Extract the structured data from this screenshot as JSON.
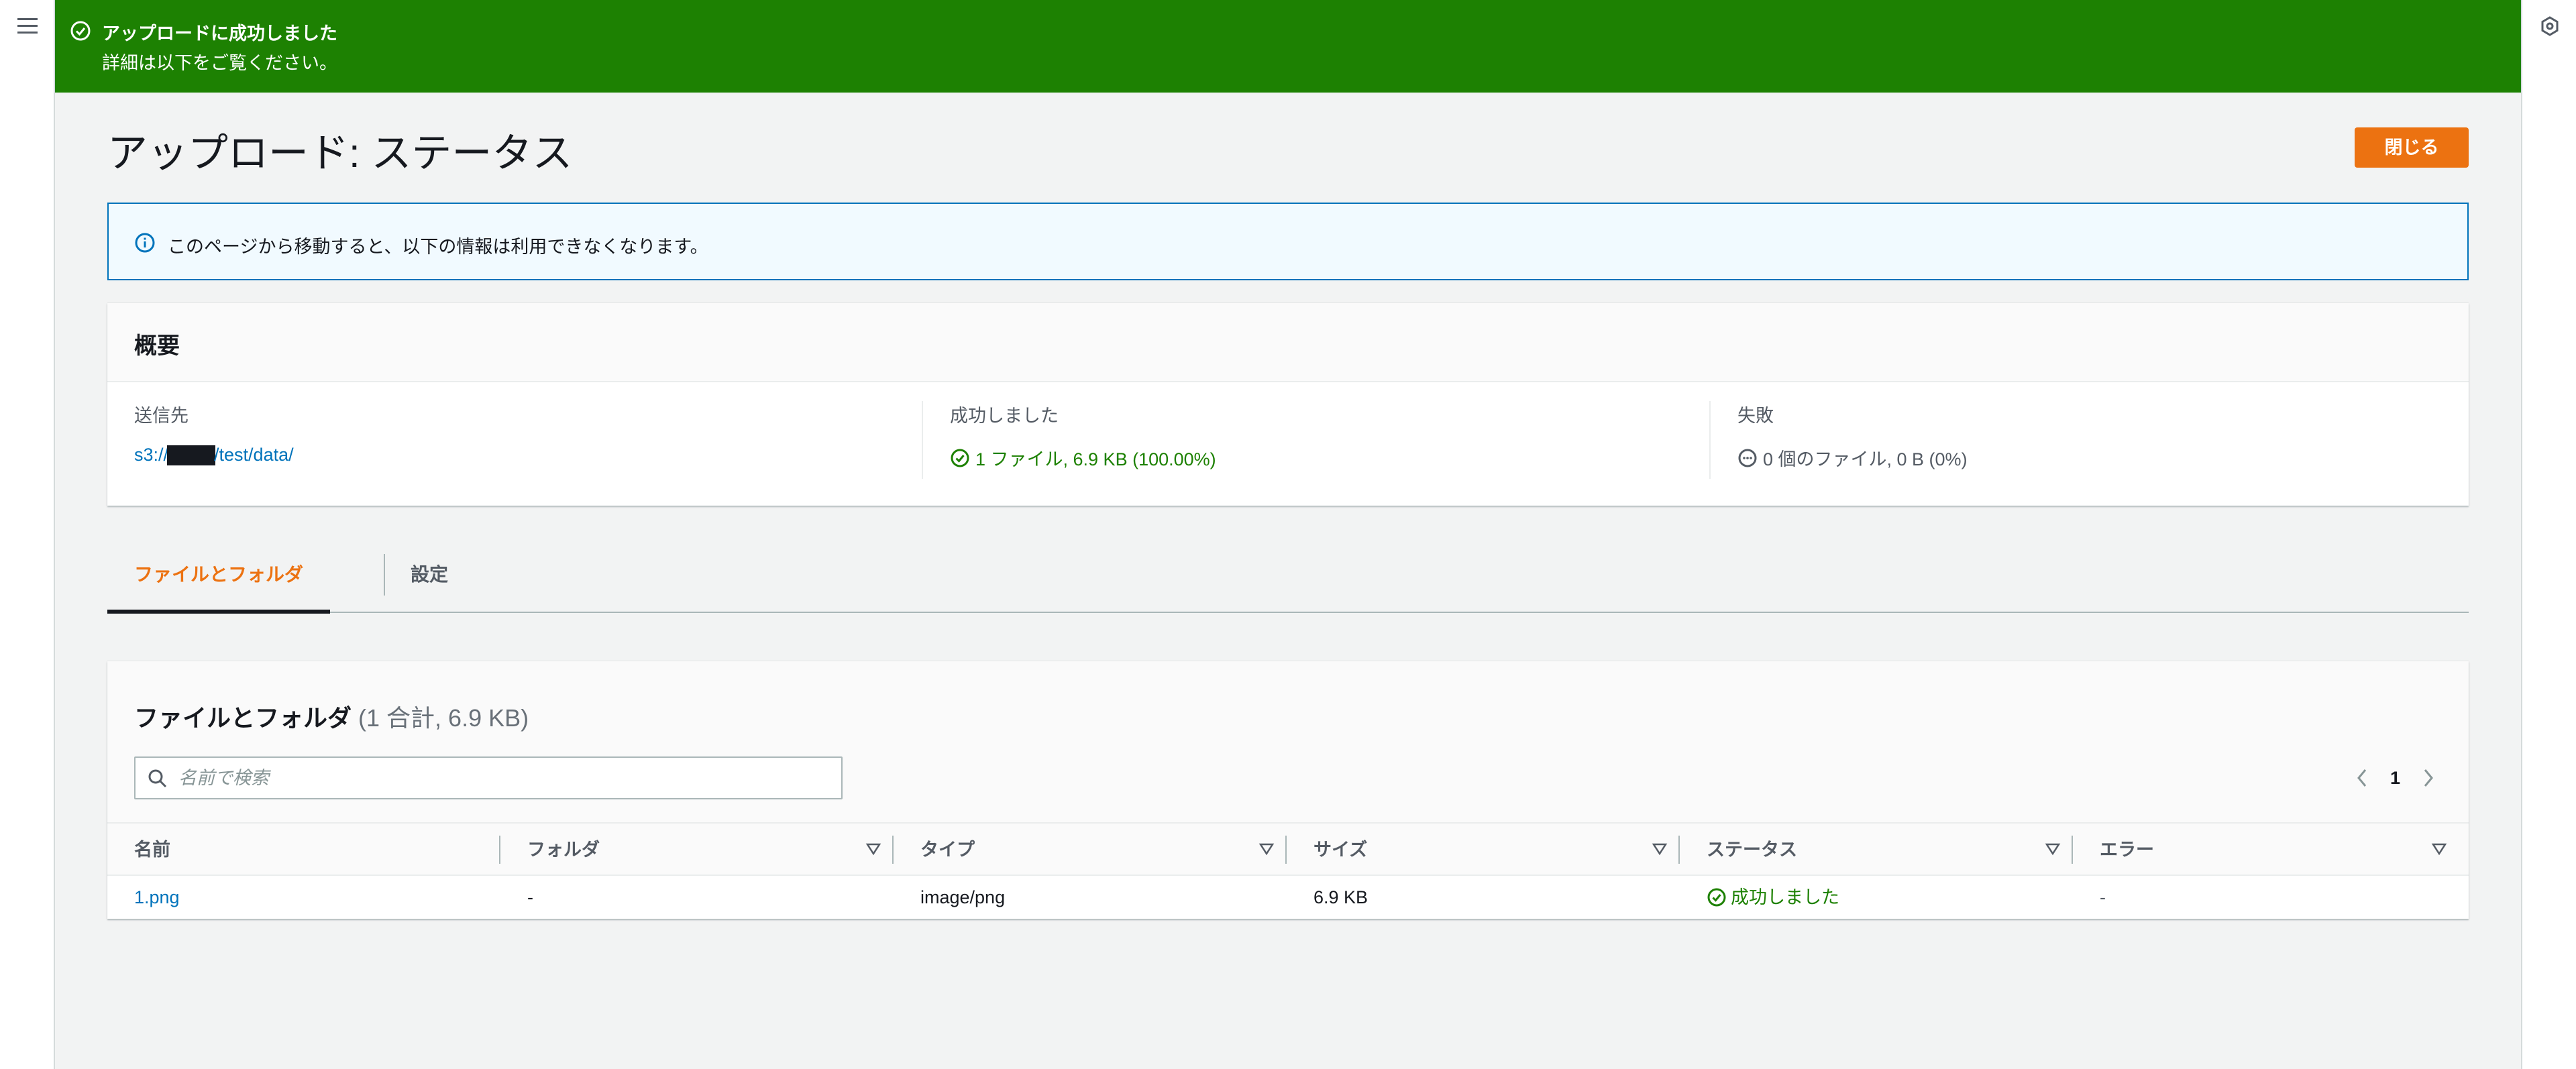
{
  "flash": {
    "title": "アップロードに成功しました",
    "message": "詳細は以下をご覧ください。",
    "color": "#1d8102"
  },
  "page": {
    "title": "アップロード: ステータス",
    "close_label": "閉じる"
  },
  "info": {
    "text": "このページから移動すると、以下の情報は利用できなくなります。"
  },
  "summary": {
    "heading": "概要",
    "destination_label": "送信先",
    "destination_prefix": "s3://",
    "destination_suffix": "/test/data/",
    "succeeded_label": "成功しました",
    "succeeded_value": "1 ファイル, 6.9 KB (100.00%)",
    "failed_label": "失敗",
    "failed_value": "0 個のファイル, 0 B (0%)"
  },
  "tabs": [
    {
      "label": "ファイルとフォルダ",
      "active": true
    },
    {
      "label": "設定",
      "active": false
    }
  ],
  "files": {
    "heading": "ファイルとフォルダ",
    "count": "(1 合計, 6.9 KB)",
    "search_placeholder": "名前で検索",
    "current_page": "1",
    "columns": [
      "名前",
      "フォルダ",
      "タイプ",
      "サイズ",
      "ステータス",
      "エラー"
    ],
    "rows": [
      {
        "name": "1.png",
        "folder": "-",
        "type": "image/png",
        "size": "6.9 KB",
        "status": "成功しました",
        "error": "-"
      }
    ]
  },
  "colors": {
    "accent": "#ec7211",
    "link": "#0073bb",
    "success": "#1d8102"
  },
  "icons": {
    "menu": "hamburger-menu-icon",
    "tools": "hexagon-tools-icon",
    "flash": "success-circle-check-icon",
    "info": "info-circle-icon",
    "search": "magnifier-icon"
  }
}
